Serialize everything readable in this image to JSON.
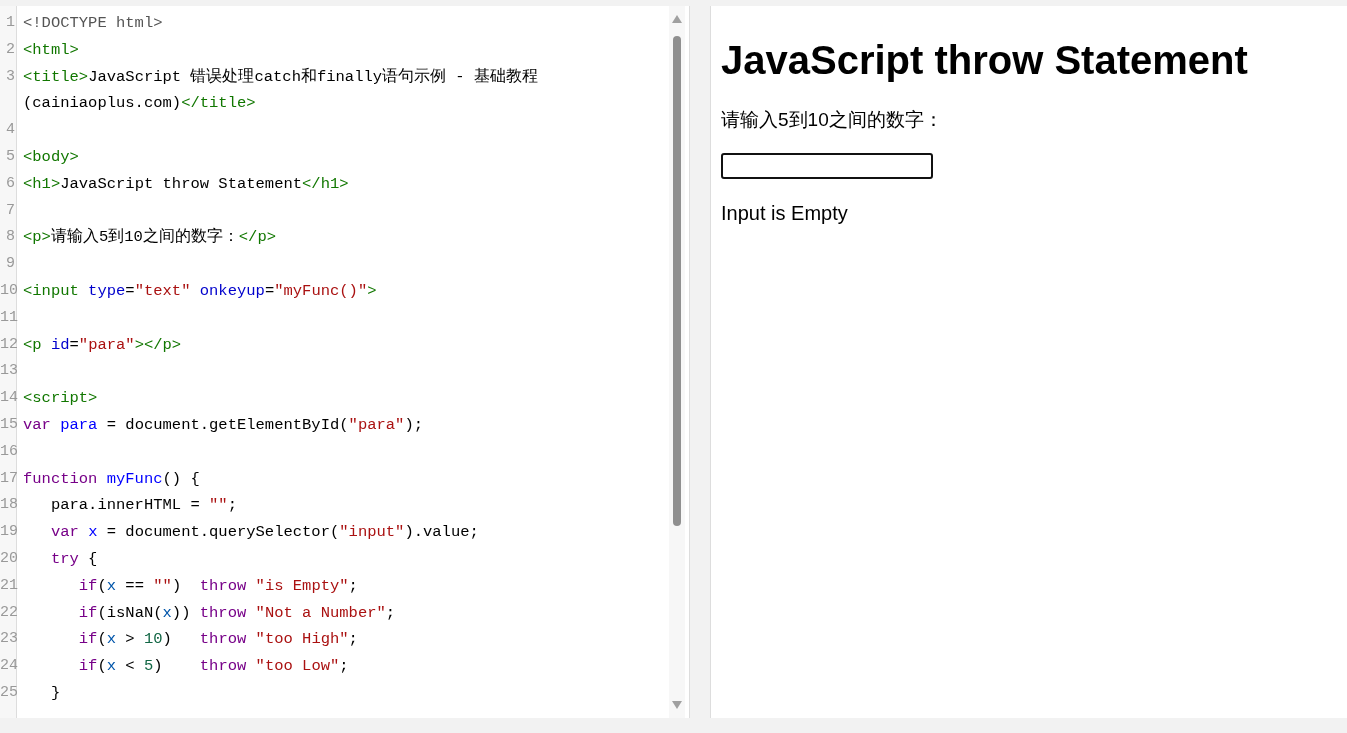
{
  "editor": {
    "lines": [
      {
        "number": "1",
        "tokens": [
          {
            "kind": "meta",
            "text": "<!DOCTYPE html>"
          }
        ]
      },
      {
        "number": "2",
        "tokens": [
          {
            "kind": "tag",
            "text": "<html>"
          }
        ]
      },
      {
        "number": "3",
        "tokens": [
          {
            "kind": "tag",
            "text": "<title>"
          },
          {
            "kind": "plain",
            "text": "JavaScript 错误处理catch和finally语句示例 - 基础教程 (cainiaoplus.com)"
          },
          {
            "kind": "tag",
            "text": "</title>"
          }
        ]
      },
      {
        "number": "4"
      },
      {
        "number": "5",
        "tokens": [
          {
            "kind": "tag",
            "text": "<body>"
          }
        ]
      },
      {
        "number": "6",
        "tokens": [
          {
            "kind": "tag",
            "text": "<h1>"
          },
          {
            "kind": "plain",
            "text": "JavaScript throw Statement"
          },
          {
            "kind": "tag",
            "text": "</h1>"
          }
        ]
      },
      {
        "number": "7"
      },
      {
        "number": "8",
        "tokens": [
          {
            "kind": "tag",
            "text": "<p>"
          },
          {
            "kind": "plain",
            "text": "请输入5到10之间的数字："
          },
          {
            "kind": "tag",
            "text": "</p>"
          }
        ]
      },
      {
        "number": "9"
      },
      {
        "number": "10",
        "tokens": [
          {
            "kind": "tag",
            "text": "<input"
          },
          {
            "kind": "attr",
            "text": " type"
          },
          {
            "kind": "plain",
            "text": "="
          },
          {
            "kind": "string",
            "text": "\"text\""
          },
          {
            "kind": "attr",
            "text": " onkeyup"
          },
          {
            "kind": "plain",
            "text": "="
          },
          {
            "kind": "string",
            "text": "\"myFunc()\""
          },
          {
            "kind": "tag",
            "text": ">"
          }
        ]
      },
      {
        "number": "11"
      },
      {
        "number": "12",
        "tokens": [
          {
            "kind": "tag",
            "text": "<p"
          },
          {
            "kind": "attr",
            "text": " id"
          },
          {
            "kind": "plain",
            "text": "="
          },
          {
            "kind": "string",
            "text": "\"para\""
          },
          {
            "kind": "tag",
            "text": "></p>"
          }
        ]
      },
      {
        "number": "13"
      },
      {
        "number": "14",
        "tokens": [
          {
            "kind": "tag",
            "text": "<script>"
          }
        ]
      },
      {
        "number": "15",
        "tokens": [
          {
            "kind": "keyword",
            "text": "var "
          },
          {
            "kind": "def",
            "text": "para"
          },
          {
            "kind": "plain",
            "text": " = document.getElementById("
          },
          {
            "kind": "string",
            "text": "\"para\""
          },
          {
            "kind": "plain",
            "text": ");"
          }
        ]
      },
      {
        "number": "16"
      },
      {
        "number": "17",
        "tokens": [
          {
            "kind": "keyword",
            "text": "function "
          },
          {
            "kind": "def",
            "text": "myFunc"
          },
          {
            "kind": "plain",
            "text": "() {"
          }
        ]
      },
      {
        "number": "18",
        "tokens": [
          {
            "kind": "plain",
            "text": "   para.innerHTML = "
          },
          {
            "kind": "string",
            "text": "\"\""
          },
          {
            "kind": "plain",
            "text": ";"
          }
        ]
      },
      {
        "number": "19",
        "tokens": [
          {
            "kind": "keyword",
            "text": "   var "
          },
          {
            "kind": "def",
            "text": "x"
          },
          {
            "kind": "plain",
            "text": " = document.querySelector("
          },
          {
            "kind": "string",
            "text": "\"input\""
          },
          {
            "kind": "plain",
            "text": ").value;"
          }
        ]
      },
      {
        "number": "20",
        "tokens": [
          {
            "kind": "keyword",
            "text": "   try"
          },
          {
            "kind": "plain",
            "text": " {"
          }
        ]
      },
      {
        "number": "21",
        "tokens": [
          {
            "kind": "keyword",
            "text": "      if"
          },
          {
            "kind": "plain",
            "text": "("
          },
          {
            "kind": "variable",
            "text": "x"
          },
          {
            "kind": "plain",
            "text": " == "
          },
          {
            "kind": "string",
            "text": "\"\""
          },
          {
            "kind": "plain",
            "text": ")  "
          },
          {
            "kind": "keyword",
            "text": "throw "
          },
          {
            "kind": "string",
            "text": "\"is Empty\""
          },
          {
            "kind": "plain",
            "text": ";"
          }
        ]
      },
      {
        "number": "22",
        "tokens": [
          {
            "kind": "keyword",
            "text": "      if"
          },
          {
            "kind": "plain",
            "text": "(isNaN("
          },
          {
            "kind": "variable",
            "text": "x"
          },
          {
            "kind": "plain",
            "text": ")) "
          },
          {
            "kind": "keyword",
            "text": "throw "
          },
          {
            "kind": "string",
            "text": "\"Not a Number\""
          },
          {
            "kind": "plain",
            "text": ";"
          }
        ]
      },
      {
        "number": "23",
        "tokens": [
          {
            "kind": "keyword",
            "text": "      if"
          },
          {
            "kind": "plain",
            "text": "("
          },
          {
            "kind": "variable",
            "text": "x"
          },
          {
            "kind": "plain",
            "text": " > "
          },
          {
            "kind": "number",
            "text": "10"
          },
          {
            "kind": "plain",
            "text": ")   "
          },
          {
            "kind": "keyword",
            "text": "throw "
          },
          {
            "kind": "string",
            "text": "\"too High\""
          },
          {
            "kind": "plain",
            "text": ";"
          }
        ]
      },
      {
        "number": "24",
        "tokens": [
          {
            "kind": "keyword",
            "text": "      if"
          },
          {
            "kind": "plain",
            "text": "("
          },
          {
            "kind": "variable",
            "text": "x"
          },
          {
            "kind": "plain",
            "text": " < "
          },
          {
            "kind": "number",
            "text": "5"
          },
          {
            "kind": "plain",
            "text": ")    "
          },
          {
            "kind": "keyword",
            "text": "throw "
          },
          {
            "kind": "string",
            "text": "\"too Low\""
          },
          {
            "kind": "plain",
            "text": ";"
          }
        ]
      },
      {
        "number": "25",
        "tokens": [
          {
            "kind": "plain",
            "text": "   }"
          }
        ]
      }
    ]
  },
  "preview": {
    "heading": "JavaScript throw Statement",
    "prompt": "请输入5到10之间的数字：",
    "message": "Input is Empty"
  }
}
